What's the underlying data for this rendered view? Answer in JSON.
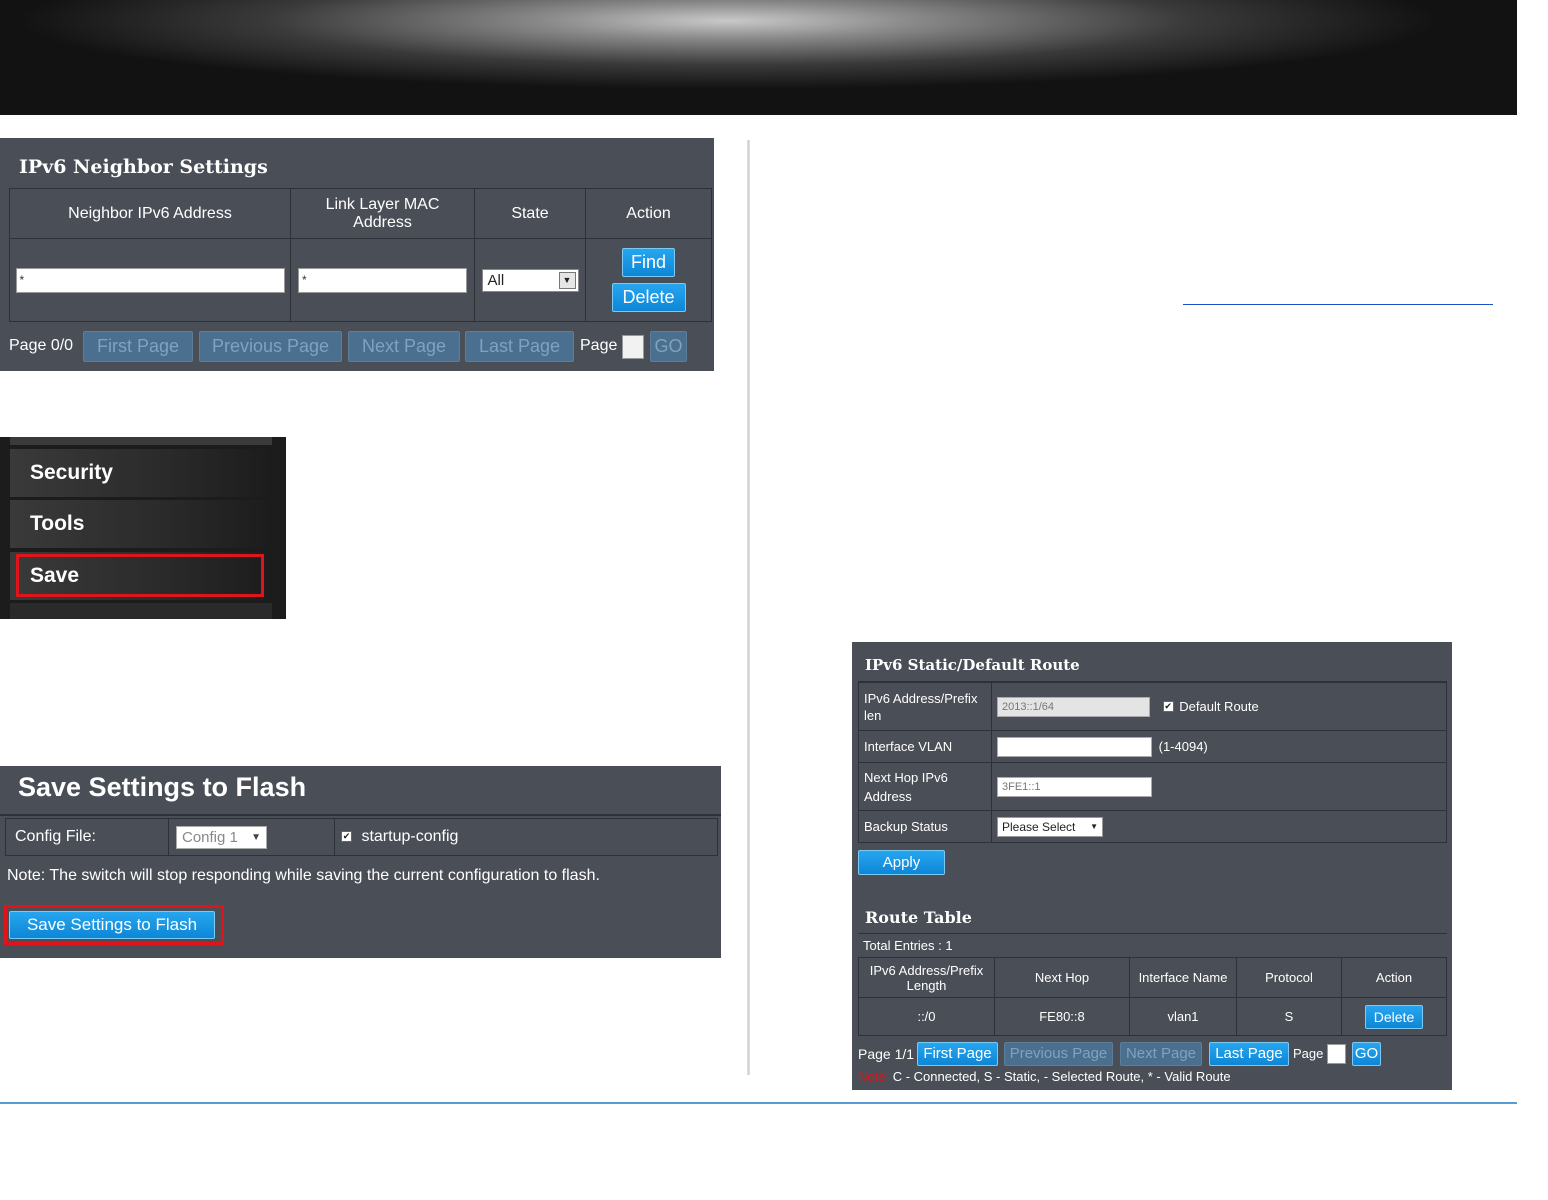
{
  "neighbor_settings": {
    "title": "IPv6 Neighbor Settings",
    "columns": [
      "Neighbor IPv6 Address",
      "Link Layer MAC Address",
      "State",
      "Action"
    ],
    "ipv6_address_value": "*",
    "mac_address_value": "*",
    "state_selected": "All",
    "find_label": "Find",
    "delete_label": "Delete",
    "pagination": {
      "page_status": "Page 0/0",
      "first": "First Page",
      "previous": "Previous Page",
      "next": "Next Page",
      "last": "Last Page",
      "page_label": "Page",
      "go": "GO"
    }
  },
  "menu": {
    "items": [
      "Security",
      "Tools",
      "Save"
    ],
    "highlighted": "Save"
  },
  "save_flash": {
    "title": "Save Settings to Flash",
    "config_file_label": "Config File:",
    "config_selected": "Config 1",
    "startup_config_label": "startup-config",
    "note": "Note: The switch will stop responding while saving the current configuration to flash.",
    "button_label": "Save Settings to Flash"
  },
  "static_route": {
    "title": "IPv6 Static/Default Route",
    "rows": {
      "prefix_label": "IPv6 Address/Prefix len",
      "prefix_value": "2013::1/64",
      "default_route_label": "Default Route",
      "vlan_label": "Interface VLAN",
      "vlan_value": "",
      "vlan_hint": "(1-4094)",
      "next_hop_label": "Next Hop IPv6 Address",
      "next_hop_value": "3FE1::1",
      "backup_label": "Backup Status",
      "backup_selected": "Please Select"
    },
    "apply_label": "Apply",
    "route_table": {
      "title": "Route Table",
      "total_entries": "Total Entries : 1",
      "columns": [
        "IPv6 Address/Prefix Length",
        "Next Hop",
        "Interface Name",
        "Protocol",
        "Action"
      ],
      "rows": [
        {
          "prefix": "::/0",
          "next_hop": "FE80::8",
          "interface": "vlan1",
          "protocol": "S",
          "action": "Delete"
        }
      ]
    },
    "pagination": {
      "page_status": "Page 1/1",
      "first": "First Page",
      "previous": "Previous Page",
      "next": "Next Page",
      "last": "Last Page",
      "page_label": "Page",
      "go": "GO"
    },
    "note_label": "Note:",
    "note_text": "C - Connected, S - Static, - Selected Route, * - Valid Route"
  },
  "colors": {
    "panel_bg": "#4a4e56",
    "button_blue": "#0d86d6",
    "highlight_red": "#e0141b",
    "link_blue": "#1f4fd1",
    "rule_blue": "#5b9bd5"
  }
}
